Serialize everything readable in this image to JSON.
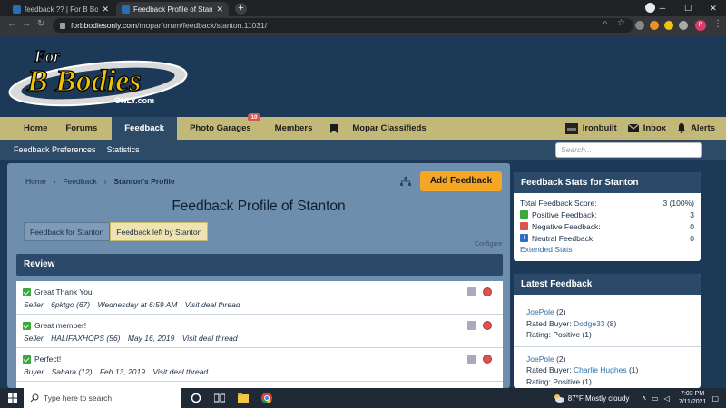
{
  "browser": {
    "tabs": [
      {
        "title": "feedback ?? | For B Bodies Only C"
      },
      {
        "title": "Feedback Profile of Stanton | For"
      }
    ],
    "url_domain": "forbbodiesonly.com",
    "url_path": "/moparforum/feedback/stanton.11031/",
    "profile_initial": "P"
  },
  "site": {
    "logo_top": "For",
    "logo_main": "B Bodies",
    "logo_bottom": "ONLY.com"
  },
  "nav": {
    "items": [
      "Home",
      "Forums",
      "Feedback",
      "Photo Garages",
      "Members",
      "",
      "Mopar Classifieds"
    ],
    "active": "Feedback",
    "badge": "10",
    "right": [
      "Ironbuilt",
      "Inbox",
      "Alerts"
    ]
  },
  "subnav": {
    "items": [
      "Feedback Preferences",
      "Statistics"
    ],
    "search_placeholder": "Search..."
  },
  "breadcrumb": [
    "Home",
    "Feedback",
    "Stanton's Profile"
  ],
  "add_feedback": "Add Feedback",
  "page_title": "Feedback Profile of Stanton",
  "tabs": [
    "Feedback for Stanton",
    "Feedback left by Stanton"
  ],
  "configure": "Configure",
  "review": {
    "heading": "Review",
    "items": [
      {
        "title": "Great Thank You",
        "role": "Seller",
        "user": "6pktgo (67)",
        "date": "Wednesday at 6:59 AM",
        "link": "Visit deal thread"
      },
      {
        "title": "Great member!",
        "role": "Seller",
        "user": "HALIFAXHOPS (56)",
        "date": "May 16, 2019",
        "link": "Visit deal thread"
      },
      {
        "title": "Perfect!",
        "role": "Buyer",
        "user": "Sahara (12)",
        "date": "Feb 13, 2019",
        "link": "Visit deal thread"
      }
    ]
  },
  "stats": {
    "heading": "Feedback Stats for Stanton",
    "total_label": "Total Feedback Score:",
    "total_value": "3 (100%)",
    "positive_label": "Positive Feedback:",
    "positive_value": "3",
    "negative_label": "Negative Feedback:",
    "negative_value": "0",
    "neutral_label": "Neutral Feedback:",
    "neutral_value": "0",
    "extended": "Extended Stats"
  },
  "latest": {
    "heading": "Latest Feedback",
    "items": [
      {
        "user": "JoePole",
        "count": "(2)",
        "rated_label": "Rated Buyer:",
        "rated_user": "Dodge33",
        "rated_count": "(8)",
        "rating": "Rating: Positive (1)"
      },
      {
        "user": "JoePole",
        "count": "(2)",
        "rated_label": "Rated Buyer:",
        "rated_user": "Charlie Hughes",
        "rated_count": "(1)",
        "rating": "Rating: Positive (1)"
      }
    ]
  },
  "taskbar": {
    "search_placeholder": "Type here to search",
    "weather": "87°F  Mostly cloudy",
    "time": "7:03 PM",
    "date": "7/11/2021"
  }
}
